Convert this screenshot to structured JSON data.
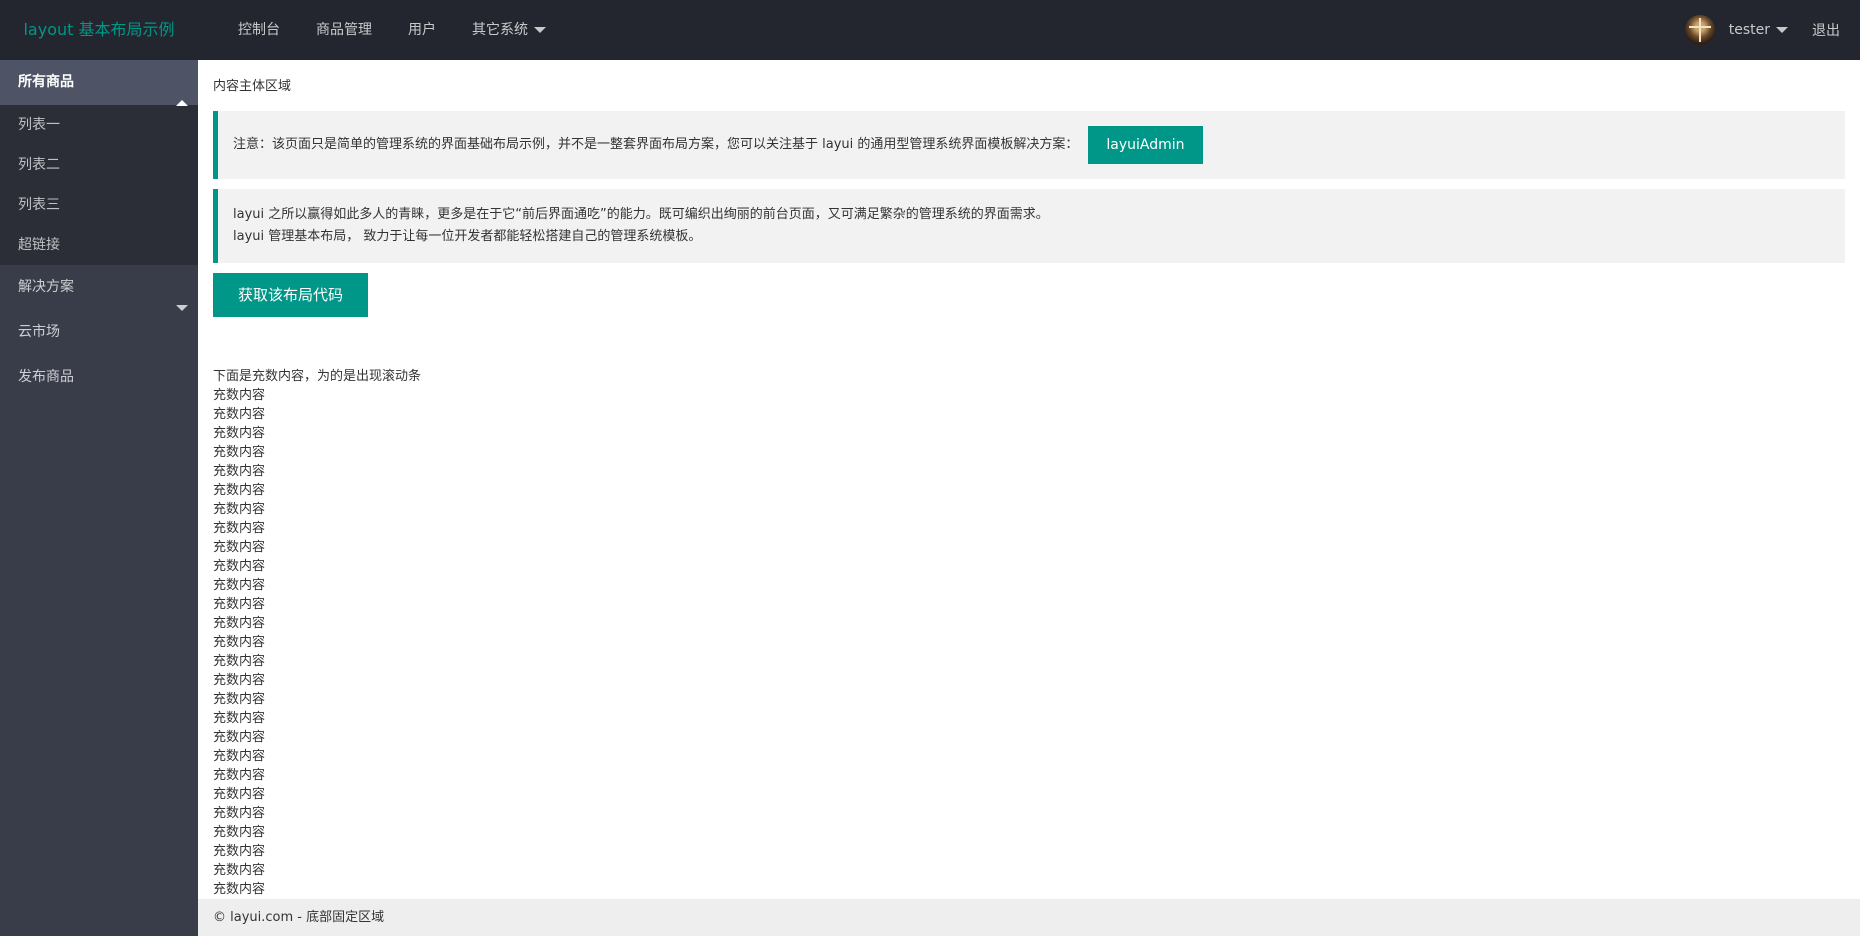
{
  "header": {
    "logo": "layout 基本布局示例",
    "nav": [
      {
        "label": "控制台"
      },
      {
        "label": "商品管理"
      },
      {
        "label": "用户"
      },
      {
        "label": "其它系统"
      }
    ],
    "username": "tester",
    "logout": "退出"
  },
  "sidebar": {
    "groups": [
      {
        "label": "所有商品",
        "children": [
          "列表一",
          "列表二",
          "列表三",
          "超链接"
        ]
      },
      {
        "label": "解决方案"
      },
      {
        "label": "云市场"
      },
      {
        "label": "发布商品"
      }
    ]
  },
  "main": {
    "area_title": "内容主体区域",
    "notice_text": "注意：该页面只是简单的管理系统的界面基础布局示例，并不是一整套界面布局方案，您可以关注基于 layui 的通用型管理系统界面模板解决方案：",
    "notice_button": "layuiAdmin",
    "quote_line1": "layui 之所以赢得如此多人的青睐，更多是在于它“前后界面通吃”的能力。既可编织出绚丽的前台页面，又可满足繁杂的管理系统的界面需求。",
    "quote_line2": "layui 管理基本布局， 致力于让每一位开发者都能轻松搭建自己的管理系统模板。",
    "get_code_button": "获取该布局代码",
    "filler_title": "下面是充数内容，为的是出现滚动条",
    "filler_line": "充数内容",
    "filler_count": 27
  },
  "footer": {
    "text": "© layui.com - 底部固定区域"
  },
  "colors": {
    "accent": "#009688",
    "header_bg": "#23262e",
    "sidebar_bg": "#393d49"
  }
}
